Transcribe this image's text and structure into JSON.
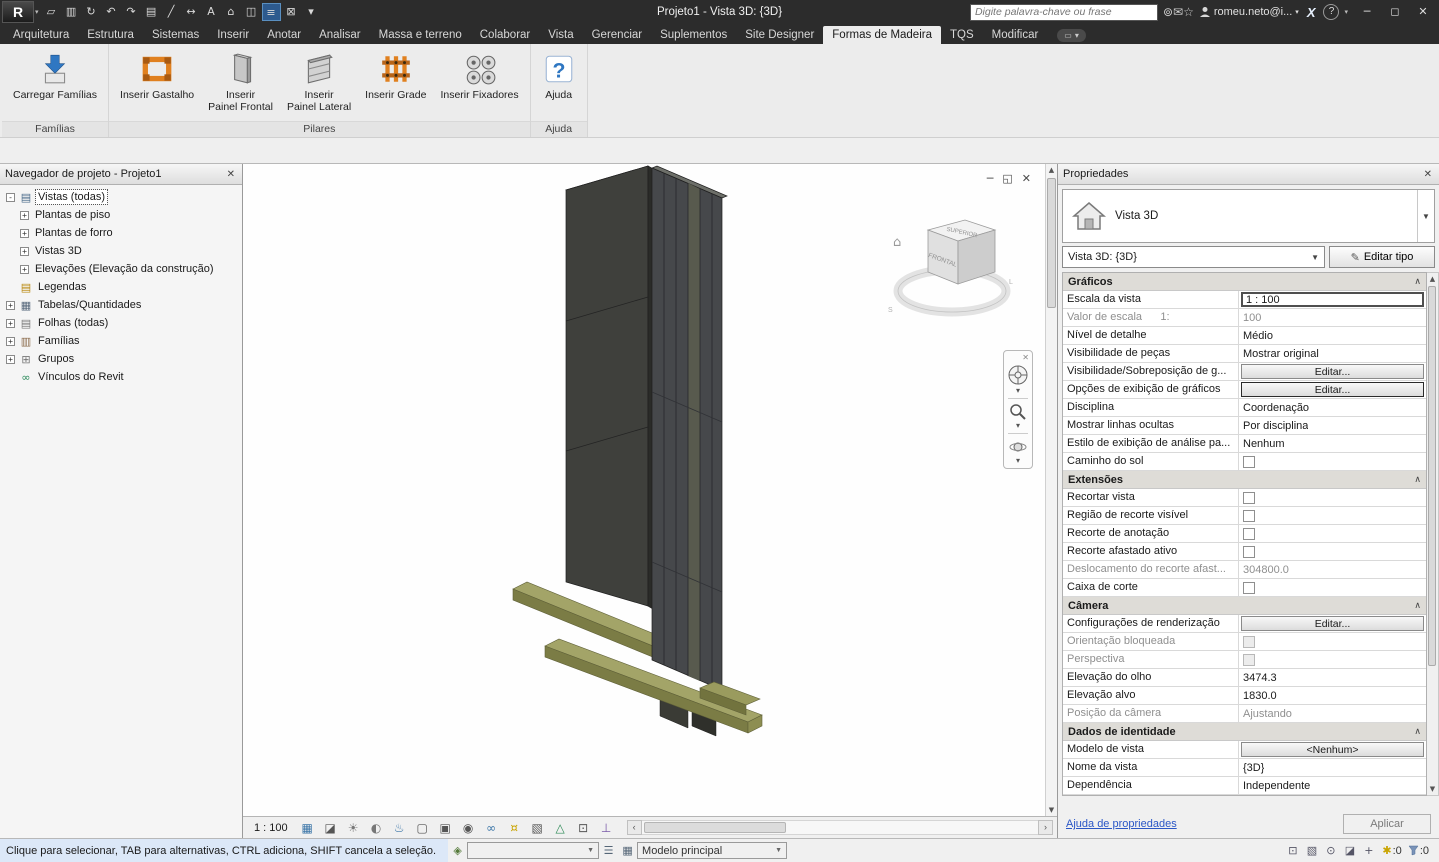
{
  "title_bar": {
    "app_title": "Projeto1 - Vista 3D: {3D}",
    "search_placeholder": "Digite palavra-chave ou frase",
    "user_name": "romeu.neto@i...",
    "qat": [
      {
        "name": "open-file-icon",
        "glyph": "▱"
      },
      {
        "name": "save-icon",
        "glyph": "▥"
      },
      {
        "name": "sync-with-central-icon",
        "glyph": "↻"
      },
      {
        "name": "undo-icon",
        "glyph": "↶"
      },
      {
        "name": "redo-icon",
        "glyph": "↷"
      },
      {
        "name": "print-icon",
        "glyph": "▤"
      },
      {
        "name": "measure-icon",
        "glyph": "╱"
      },
      {
        "name": "aligned-dimension-icon",
        "glyph": "↔"
      },
      {
        "name": "text-icon",
        "glyph": "A"
      },
      {
        "name": "default-3d-view-icon",
        "glyph": "⌂"
      },
      {
        "name": "section-icon",
        "glyph": "◫"
      },
      {
        "name": "thin-lines-icon",
        "glyph": "≡",
        "active": true
      },
      {
        "name": "close-hidden-windows-icon",
        "glyph": "⊠"
      },
      {
        "name": "switch-windows-icon",
        "glyph": "▾"
      }
    ],
    "right_icons": [
      {
        "name": "search-icon",
        "glyph": "⊚"
      },
      {
        "name": "communication-center-icon",
        "glyph": "✉"
      },
      {
        "name": "favorites-icon",
        "glyph": "☆"
      }
    ],
    "window_buttons": [
      {
        "name": "minimize-button",
        "glyph": "─"
      },
      {
        "name": "maximize-button",
        "glyph": "◻"
      },
      {
        "name": "close-button",
        "glyph": "✕"
      }
    ]
  },
  "ribbon": {
    "tabs": [
      "Arquitetura",
      "Estrutura",
      "Sistemas",
      "Inserir",
      "Anotar",
      "Analisar",
      "Massa e terreno",
      "Colaborar",
      "Vista",
      "Gerenciar",
      "Suplementos",
      "Site Designer",
      "Formas de Madeira",
      "TQS",
      "Modificar"
    ],
    "active_tab": "Formas de Madeira",
    "groups": [
      {
        "label": "Famílias",
        "buttons": [
          {
            "label": "Carregar Famílias",
            "icon": "load-families-icon"
          }
        ]
      },
      {
        "label": "Pilares",
        "buttons": [
          {
            "label": "Inserir Gastalho",
            "icon": "gastalho-icon"
          },
          {
            "label": "Inserir\nPainel Frontal",
            "icon": "painel-frontal-icon"
          },
          {
            "label": "Inserir\nPainel Lateral",
            "icon": "painel-lateral-icon"
          },
          {
            "label": "Inserir Grade",
            "icon": "grade-icon"
          },
          {
            "label": "Inserir Fixadores",
            "icon": "fixadores-icon"
          }
        ]
      },
      {
        "label": "Ajuda",
        "buttons": [
          {
            "label": "Ajuda",
            "icon": "help-icon"
          }
        ]
      }
    ]
  },
  "project_browser": {
    "title": "Navegador de projeto - Projeto1",
    "items": [
      {
        "label": "Vistas (todas)",
        "level": 0,
        "expander": "-",
        "icon": "views-icon",
        "glyph": "▤",
        "color": "#4a6b8a",
        "selected": true
      },
      {
        "label": "Plantas de piso",
        "level": 1,
        "expander": "+"
      },
      {
        "label": "Plantas de forro",
        "level": 1,
        "expander": "+"
      },
      {
        "label": "Vistas 3D",
        "level": 1,
        "expander": "+"
      },
      {
        "label": "Elevações (Elevação da construção)",
        "level": 1,
        "expander": "+"
      },
      {
        "label": "Legendas",
        "level": 0,
        "icon": "legends-icon",
        "glyph": "▤",
        "color": "#b8860b"
      },
      {
        "label": "Tabelas/Quantidades",
        "level": 0,
        "expander": "+",
        "icon": "schedules-icon",
        "glyph": "▦",
        "color": "#55677a"
      },
      {
        "label": "Folhas (todas)",
        "level": 0,
        "expander": "+",
        "icon": "sheets-icon",
        "glyph": "▤",
        "color": "#777777"
      },
      {
        "label": "Famílias",
        "level": 0,
        "expander": "+",
        "icon": "families-icon",
        "glyph": "▥",
        "color": "#8a6a4a"
      },
      {
        "label": "Grupos",
        "level": 0,
        "expander": "+",
        "icon": "groups-icon",
        "glyph": "⊞",
        "color": "#777777"
      },
      {
        "label": "Vínculos do Revit",
        "level": 0,
        "icon": "revit-links-icon",
        "glyph": "∞",
        "color": "#2a8a5a"
      }
    ]
  },
  "viewport": {
    "scale": "1 : 100",
    "viewcube": {
      "top": "SUPERIOR",
      "front": "FRONTAL",
      "compass_s": "S",
      "compass_l": "L"
    },
    "window_buttons": [
      {
        "name": "view-minimize-button",
        "glyph": "─"
      },
      {
        "name": "view-restore-button",
        "glyph": "◱"
      },
      {
        "name": "view-close-button",
        "glyph": "✕"
      }
    ],
    "toolbar_icons": [
      {
        "name": "detail-level-icon",
        "glyph": "▦",
        "color": "#3c76a8"
      },
      {
        "name": "visual-style-icon",
        "glyph": "◪",
        "color": "#555555"
      },
      {
        "name": "sun-path-icon",
        "glyph": "☀",
        "color": "#777777"
      },
      {
        "name": "shadows-icon",
        "glyph": "◐",
        "color": "#777777"
      },
      {
        "name": "show-rendering-dialog-icon",
        "glyph": "♨",
        "color": "#3c76a8"
      },
      {
        "name": "crop-view-icon",
        "glyph": "▢",
        "color": "#555555"
      },
      {
        "name": "show-crop-region-icon",
        "glyph": "▣",
        "color": "#555555"
      },
      {
        "name": "lock-3d-view-icon",
        "glyph": "◉",
        "color": "#555555"
      },
      {
        "name": "temporary-hide-isolate-icon",
        "glyph": "∞",
        "color": "#3c76a8"
      },
      {
        "name": "reveal-hidden-elements-icon",
        "glyph": "¤",
        "color": "#c9a400"
      },
      {
        "name": "temporary-view-properties-icon",
        "glyph": "▧",
        "color": "#555555"
      },
      {
        "name": "show-analytical-model-icon",
        "glyph": "△",
        "color": "#2e8b57"
      },
      {
        "name": "highlight-displacement-sets-icon",
        "glyph": "⊡",
        "color": "#555555"
      },
      {
        "name": "reveal-constraints-icon",
        "glyph": "⊥",
        "color": "#7a5aa8"
      }
    ]
  },
  "properties": {
    "title": "Propriedades",
    "type_label": "Vista 3D",
    "instance_selector": "Vista 3D: {3D}",
    "edit_type_label": "Editar tipo",
    "sections": [
      {
        "title": "Gráficos",
        "rows": [
          {
            "label": "Escala da vista",
            "value": "1 : 100",
            "kind": "sel"
          },
          {
            "label": "Valor de escala      1:",
            "value": "100",
            "kind": "text",
            "disabled": true
          },
          {
            "label": "Nível de detalhe",
            "value": "Médio",
            "kind": "text"
          },
          {
            "label": "Visibilidade de peças",
            "value": "Mostrar original",
            "kind": "text"
          },
          {
            "label": "Visibilidade/Sobreposição de g...",
            "value": "Editar...",
            "kind": "button"
          },
          {
            "label": "Opções de exibição de gráficos",
            "value": "Editar...",
            "kind": "button-focus"
          },
          {
            "label": "Disciplina",
            "value": "Coordenação",
            "kind": "text"
          },
          {
            "label": "Mostrar linhas ocultas",
            "value": "Por disciplina",
            "kind": "text"
          },
          {
            "label": "Estilo de exibição de análise pa...",
            "value": "Nenhum",
            "kind": "text"
          },
          {
            "label": "Caminho do sol",
            "value": "",
            "kind": "check"
          }
        ]
      },
      {
        "title": "Extensões",
        "rows": [
          {
            "label": "Recortar vista",
            "value": "",
            "kind": "check"
          },
          {
            "label": "Região de recorte visível",
            "value": "",
            "kind": "check"
          },
          {
            "label": "Recorte de anotação",
            "value": "",
            "kind": "check"
          },
          {
            "label": "Recorte afastado ativo",
            "value": "",
            "kind": "check"
          },
          {
            "label": "Deslocamento do recorte afast...",
            "value": "304800.0",
            "kind": "text",
            "disabled": true
          },
          {
            "label": "Caixa de corte",
            "value": "",
            "kind": "check"
          }
        ]
      },
      {
        "title": "Câmera",
        "rows": [
          {
            "label": "Configurações de renderização",
            "value": "Editar...",
            "kind": "button"
          },
          {
            "label": "Orientação bloqueada",
            "value": "",
            "kind": "check",
            "disabled": true
          },
          {
            "label": "Perspectiva",
            "value": "",
            "kind": "check",
            "disabled": true
          },
          {
            "label": "Elevação do olho",
            "value": "3474.3",
            "kind": "text"
          },
          {
            "label": "Elevação alvo",
            "value": "1830.0",
            "kind": "text"
          },
          {
            "label": "Posição da câmera",
            "value": "Ajustando",
            "kind": "text",
            "disabled": true
          }
        ]
      },
      {
        "title": "Dados de identidade",
        "rows": [
          {
            "label": "Modelo de vista",
            "value": "<Nenhum>",
            "kind": "button"
          },
          {
            "label": "Nome da vista",
            "value": "{3D}",
            "kind": "text"
          },
          {
            "label": "Dependência",
            "value": "Independente",
            "kind": "text"
          }
        ]
      }
    ],
    "help_link": "Ajuda de propriedades",
    "apply_label": "Aplicar"
  },
  "status_bar": {
    "hint": "Clique para selecionar, TAB para alternativas, CTRL adiciona, SHIFT cancela a seleção.",
    "worksets_value": "",
    "design_option_value": "Modelo principal",
    "left_icons": [
      {
        "name": "worksets-icon",
        "glyph": "◈",
        "color": "#557a3a"
      },
      {
        "name": "editing-requests-icon",
        "glyph": "☰",
        "color": "#556677"
      },
      {
        "name": "design-options-icon",
        "glyph": "▦",
        "color": "#556677"
      }
    ],
    "right_icons": [
      {
        "name": "select-links-icon",
        "glyph": "⊡"
      },
      {
        "name": "select-underlay-elements-icon",
        "glyph": "▧"
      },
      {
        "name": "select-pinned-elements-icon",
        "glyph": "⊙"
      },
      {
        "name": "select-elements-by-face-icon",
        "glyph": "◪"
      },
      {
        "name": "drag-elements-on-selection-icon",
        "glyph": "+"
      }
    ],
    "selection_count": ":0",
    "filter_count": ":0"
  }
}
